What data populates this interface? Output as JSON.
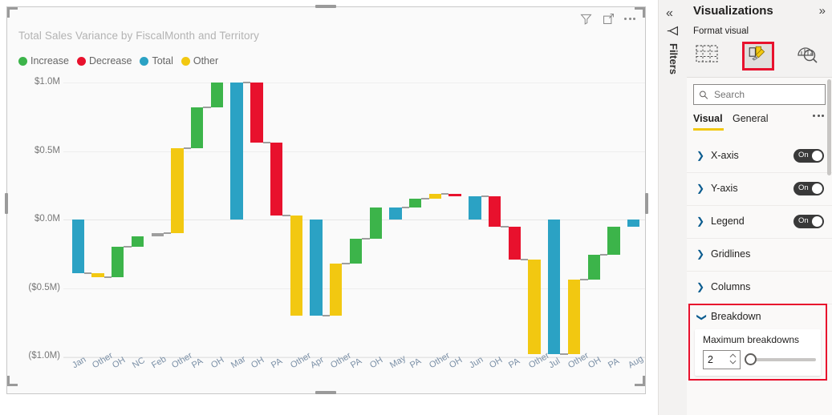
{
  "visual": {
    "title": "Total Sales Variance by FiscalMonth and Territory",
    "actions": {
      "filter": "filter-icon",
      "focus": "focus-mode-icon",
      "more": "more-options-icon"
    }
  },
  "legend": [
    {
      "label": "Increase",
      "color": "#3cb44a"
    },
    {
      "label": "Decrease",
      "color": "#e8112d"
    },
    {
      "label": "Total",
      "color": "#2ba2c4"
    },
    {
      "label": "Other",
      "color": "#f2c811"
    }
  ],
  "chart_data": {
    "type": "bar",
    "chart_subtype": "waterfall",
    "title": "Total Sales Variance by FiscalMonth and Territory",
    "xlabel": "",
    "ylabel": "",
    "ylim": [
      -1.0,
      1.0
    ],
    "ytick_labels": [
      "$1.0M",
      "$0.5M",
      "$0.0M",
      "($0.5M)",
      "($1.0M)"
    ],
    "ytick_values": [
      1.0,
      0.5,
      0.0,
      -0.5,
      -1.0
    ],
    "grid": true,
    "legend_position": "top-left",
    "units": "millions USD",
    "categories": [
      "Jan",
      "Other",
      "OH",
      "NC",
      "Feb",
      "Other",
      "PA",
      "OH",
      "Mar",
      "OH",
      "PA",
      "Other",
      "Apr",
      "Other",
      "PA",
      "OH",
      "May",
      "PA",
      "Other",
      "OH",
      "Jun",
      "OH",
      "PA",
      "Other",
      "Jul",
      "Other",
      "OH",
      "PA",
      "Aug"
    ],
    "bars": [
      {
        "label": "Jan",
        "type": "Total",
        "color": "#2ba2c4",
        "start": 0.0,
        "end": -0.39
      },
      {
        "label": "Other",
        "type": "Other",
        "color": "#f2c811",
        "start": -0.39,
        "end": -0.42
      },
      {
        "label": "OH",
        "type": "Increase",
        "color": "#3cb44a",
        "start": -0.42,
        "end": -0.2
      },
      {
        "label": "NC",
        "type": "Increase",
        "color": "#3cb44a",
        "start": -0.2,
        "end": -0.12
      },
      {
        "label": "Feb",
        "type": "Total",
        "color": "#9e9e9e",
        "start": -0.12,
        "end": -0.1
      },
      {
        "label": "Other",
        "type": "Other",
        "color": "#f2c811",
        "start": -0.1,
        "end": 0.52
      },
      {
        "label": "PA",
        "type": "Increase",
        "color": "#3cb44a",
        "start": 0.52,
        "end": 0.82
      },
      {
        "label": "OH",
        "type": "Increase",
        "color": "#3cb44a",
        "start": 0.82,
        "end": 1.0
      },
      {
        "label": "Mar",
        "type": "Total",
        "color": "#2ba2c4",
        "start": 0.0,
        "end": 1.0
      },
      {
        "label": "OH",
        "type": "Decrease",
        "color": "#e8112d",
        "start": 1.0,
        "end": 0.56
      },
      {
        "label": "PA",
        "type": "Decrease",
        "color": "#e8112d",
        "start": 0.56,
        "end": 0.03
      },
      {
        "label": "Other",
        "type": "Other",
        "color": "#f2c811",
        "start": 0.03,
        "end": -0.7
      },
      {
        "label": "Apr",
        "type": "Total",
        "color": "#2ba2c4",
        "start": 0.0,
        "end": -0.7
      },
      {
        "label": "Other",
        "type": "Other",
        "color": "#f2c811",
        "start": -0.7,
        "end": -0.32
      },
      {
        "label": "PA",
        "type": "Increase",
        "color": "#3cb44a",
        "start": -0.32,
        "end": -0.14
      },
      {
        "label": "OH",
        "type": "Increase",
        "color": "#3cb44a",
        "start": -0.14,
        "end": 0.09
      },
      {
        "label": "May",
        "type": "Total",
        "color": "#2ba2c4",
        "start": 0.0,
        "end": 0.09
      },
      {
        "label": "PA",
        "type": "Increase",
        "color": "#3cb44a",
        "start": 0.09,
        "end": 0.15
      },
      {
        "label": "Other",
        "type": "Other",
        "color": "#f2c811",
        "start": 0.15,
        "end": 0.19
      },
      {
        "label": "OH",
        "type": "Decrease",
        "color": "#e8112d",
        "start": 0.19,
        "end": 0.17
      },
      {
        "label": "Jun",
        "type": "Total",
        "color": "#2ba2c4",
        "start": 0.0,
        "end": 0.17
      },
      {
        "label": "OH",
        "type": "Decrease",
        "color": "#e8112d",
        "start": 0.17,
        "end": -0.05
      },
      {
        "label": "PA",
        "type": "Decrease",
        "color": "#e8112d",
        "start": -0.05,
        "end": -0.29
      },
      {
        "label": "Other",
        "type": "Other",
        "color": "#f2c811",
        "start": -0.29,
        "end": -0.98
      },
      {
        "label": "Jul",
        "type": "Total",
        "color": "#2ba2c4",
        "start": 0.0,
        "end": -0.98
      },
      {
        "label": "Other",
        "type": "Other",
        "color": "#f2c811",
        "start": -0.98,
        "end": -0.44
      },
      {
        "label": "OH",
        "type": "Increase",
        "color": "#3cb44a",
        "start": -0.44,
        "end": -0.26
      },
      {
        "label": "PA",
        "type": "Increase",
        "color": "#3cb44a",
        "start": -0.26,
        "end": -0.05
      },
      {
        "label": "Aug",
        "type": "Total",
        "color": "#2ba2c4",
        "start": 0.0,
        "end": -0.05
      }
    ]
  },
  "rail": {
    "collapse": "«",
    "filters_label": "Filters",
    "filter_arrow_icon": "filter-arrow-icon"
  },
  "panel": {
    "title": "Visualizations",
    "expand": "»",
    "format_visual_label": "Format visual",
    "tabs": [
      {
        "name": "fields",
        "icon": "fields-table-icon",
        "selected": false
      },
      {
        "name": "format",
        "icon": "paint-roller-icon",
        "selected": true
      },
      {
        "name": "analytics",
        "icon": "analytics-magnifier-icon",
        "selected": false
      }
    ],
    "search": {
      "placeholder": "Search",
      "value": ""
    },
    "subtabs": [
      {
        "label": "Visual",
        "selected": true
      },
      {
        "label": "General",
        "selected": false
      }
    ],
    "sections": [
      {
        "label": "X-axis",
        "expanded": false,
        "toggle": "On"
      },
      {
        "label": "Y-axis",
        "expanded": false,
        "toggle": "On"
      },
      {
        "label": "Legend",
        "expanded": false,
        "toggle": "On"
      },
      {
        "label": "Gridlines",
        "expanded": false,
        "toggle": null
      },
      {
        "label": "Columns",
        "expanded": false,
        "toggle": null
      }
    ],
    "breakdown": {
      "label": "Breakdown",
      "expanded": true,
      "max_breakdowns_label": "Maximum breakdowns",
      "max_breakdowns_value": "2"
    },
    "highlight_color": "#e8112d",
    "accent_color": "#f2c811"
  }
}
